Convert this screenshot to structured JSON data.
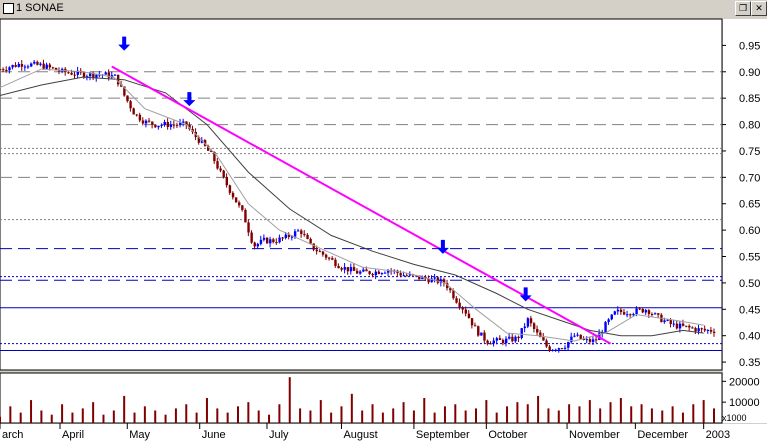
{
  "window": {
    "title": "1 SONAE",
    "restore_glyph": "❐",
    "close_glyph": "✕"
  },
  "chart_data": {
    "type": "line",
    "title": "1 SONAE",
    "price_axis": {
      "ylim": [
        0.335,
        1.0
      ],
      "ticks": [
        0.95,
        0.9,
        0.85,
        0.8,
        0.75,
        0.7,
        0.65,
        0.6,
        0.55,
        0.5,
        0.45,
        0.4,
        0.35
      ],
      "tick_labels": [
        "0.95",
        "0.90",
        "0.85",
        "0.80",
        "0.75",
        "0.70",
        "0.65",
        "0.60",
        "0.55",
        "0.50",
        "0.45",
        "0.40",
        "0.35"
      ]
    },
    "volume_axis": {
      "ylim": [
        0,
        24000
      ],
      "ticks": [
        20000,
        10000
      ],
      "tick_labels": [
        "20000",
        "10000"
      ],
      "unit_label": "x1000"
    },
    "x_range": [
      0,
      690
    ],
    "month_labels": [
      {
        "label": "arch",
        "x": 0
      },
      {
        "label": "April",
        "x": 58
      },
      {
        "label": "May",
        "x": 123
      },
      {
        "label": "June",
        "x": 193
      },
      {
        "label": "July",
        "x": 258
      },
      {
        "label": "August",
        "x": 330
      },
      {
        "label": "September",
        "x": 400
      },
      {
        "label": "October",
        "x": 470
      },
      {
        "label": "November",
        "x": 548
      },
      {
        "label": "December",
        "x": 614
      },
      {
        "label": "2003",
        "x": 680
      }
    ],
    "price_close": [
      [
        0,
        0.905
      ],
      [
        20,
        0.915
      ],
      [
        40,
        0.912
      ],
      [
        60,
        0.9
      ],
      [
        80,
        0.895
      ],
      [
        100,
        0.895
      ],
      [
        112,
        0.89
      ],
      [
        120,
        0.855
      ],
      [
        130,
        0.82
      ],
      [
        140,
        0.805
      ],
      [
        150,
        0.8
      ],
      [
        165,
        0.8
      ],
      [
        180,
        0.8
      ],
      [
        185,
        0.785
      ],
      [
        195,
        0.765
      ],
      [
        205,
        0.74
      ],
      [
        215,
        0.7
      ],
      [
        225,
        0.665
      ],
      [
        235,
        0.63
      ],
      [
        245,
        0.57
      ],
      [
        255,
        0.58
      ],
      [
        265,
        0.58
      ],
      [
        275,
        0.585
      ],
      [
        290,
        0.6
      ],
      [
        300,
        0.57
      ],
      [
        315,
        0.55
      ],
      [
        330,
        0.53
      ],
      [
        345,
        0.52
      ],
      [
        360,
        0.52
      ],
      [
        375,
        0.525
      ],
      [
        390,
        0.515
      ],
      [
        405,
        0.51
      ],
      [
        420,
        0.505
      ],
      [
        430,
        0.5
      ],
      [
        440,
        0.47
      ],
      [
        450,
        0.445
      ],
      [
        460,
        0.41
      ],
      [
        470,
        0.39
      ],
      [
        485,
        0.39
      ],
      [
        500,
        0.395
      ],
      [
        510,
        0.43
      ],
      [
        520,
        0.4
      ],
      [
        530,
        0.375
      ],
      [
        545,
        0.38
      ],
      [
        555,
        0.4
      ],
      [
        565,
        0.39
      ],
      [
        575,
        0.39
      ],
      [
        585,
        0.42
      ],
      [
        595,
        0.445
      ],
      [
        610,
        0.445
      ],
      [
        625,
        0.45
      ],
      [
        635,
        0.435
      ],
      [
        650,
        0.42
      ],
      [
        665,
        0.415
      ],
      [
        680,
        0.41
      ]
    ],
    "ma_short": [
      [
        0,
        0.87
      ],
      [
        40,
        0.905
      ],
      [
        80,
        0.9
      ],
      [
        110,
        0.89
      ],
      [
        140,
        0.83
      ],
      [
        180,
        0.8
      ],
      [
        210,
        0.74
      ],
      [
        240,
        0.65
      ],
      [
        270,
        0.6
      ],
      [
        310,
        0.565
      ],
      [
        350,
        0.53
      ],
      [
        390,
        0.52
      ],
      [
        430,
        0.5
      ],
      [
        460,
        0.45
      ],
      [
        490,
        0.405
      ],
      [
        520,
        0.4
      ],
      [
        555,
        0.39
      ],
      [
        585,
        0.405
      ],
      [
        615,
        0.44
      ],
      [
        650,
        0.43
      ],
      [
        680,
        0.42
      ]
    ],
    "ma_long": [
      [
        0,
        0.855
      ],
      [
        40,
        0.875
      ],
      [
        80,
        0.89
      ],
      [
        120,
        0.885
      ],
      [
        160,
        0.86
      ],
      [
        200,
        0.8
      ],
      [
        240,
        0.71
      ],
      [
        280,
        0.64
      ],
      [
        320,
        0.59
      ],
      [
        360,
        0.56
      ],
      [
        400,
        0.535
      ],
      [
        440,
        0.515
      ],
      [
        480,
        0.48
      ],
      [
        510,
        0.45
      ],
      [
        540,
        0.43
      ],
      [
        570,
        0.41
      ],
      [
        600,
        0.4
      ],
      [
        630,
        0.4
      ],
      [
        660,
        0.41
      ],
      [
        680,
        0.405
      ]
    ],
    "trendline": {
      "from": [
        108,
        0.91
      ],
      "to": [
        590,
        0.385
      ]
    },
    "signal_arrows": [
      {
        "x": 120,
        "y": 0.94
      },
      {
        "x": 183,
        "y": 0.835
      },
      {
        "x": 428,
        "y": 0.555
      },
      {
        "x": 508,
        "y": 0.465
      }
    ],
    "horizontal_levels": [
      {
        "y": 0.9,
        "style": "dash",
        "color": "#808080"
      },
      {
        "y": 0.85,
        "style": "dash",
        "color": "#808080"
      },
      {
        "y": 0.8,
        "style": "dash",
        "color": "#808080"
      },
      {
        "y": 0.755,
        "style": "dot",
        "color": "#808080"
      },
      {
        "y": 0.745,
        "style": "dot",
        "color": "#808080"
      },
      {
        "y": 0.7,
        "style": "dash",
        "color": "#808080"
      },
      {
        "y": 0.62,
        "style": "dot",
        "color": "#808080"
      },
      {
        "y": 0.565,
        "style": "dash",
        "color": "#0000c0"
      },
      {
        "y": 0.512,
        "style": "dot",
        "color": "#0000c0"
      },
      {
        "y": 0.505,
        "style": "dash",
        "color": "#0000c0"
      },
      {
        "y": 0.453,
        "style": "solid",
        "color": "#0000c0"
      },
      {
        "y": 0.385,
        "style": "dot",
        "color": "#0000c0"
      },
      {
        "y": 0.372,
        "style": "solid",
        "color": "#0000c0"
      }
    ],
    "volume": [
      3,
      8,
      5,
      11,
      6,
      4,
      9,
      5,
      7,
      10,
      4,
      6,
      13,
      5,
      8,
      6,
      4,
      7,
      9,
      5,
      12,
      7,
      5,
      8,
      10,
      6,
      4,
      9,
      22,
      7,
      6,
      11,
      5,
      8,
      14,
      6,
      9,
      5,
      7,
      10,
      6,
      12,
      5,
      8,
      9,
      6,
      7,
      11,
      5,
      8,
      10,
      9,
      13,
      7,
      6,
      9,
      8,
      11,
      7,
      10,
      12,
      8,
      9,
      7,
      6,
      8,
      5,
      9,
      11,
      7
    ],
    "colors": {
      "background": "#ffffff",
      "up": "#0000ff",
      "down": "#800000",
      "trend": "#ff00ff",
      "ma_short": "#a0a0a0",
      "ma_long": "#404040",
      "arrow": "#0000ff",
      "axis": "#000000"
    }
  }
}
